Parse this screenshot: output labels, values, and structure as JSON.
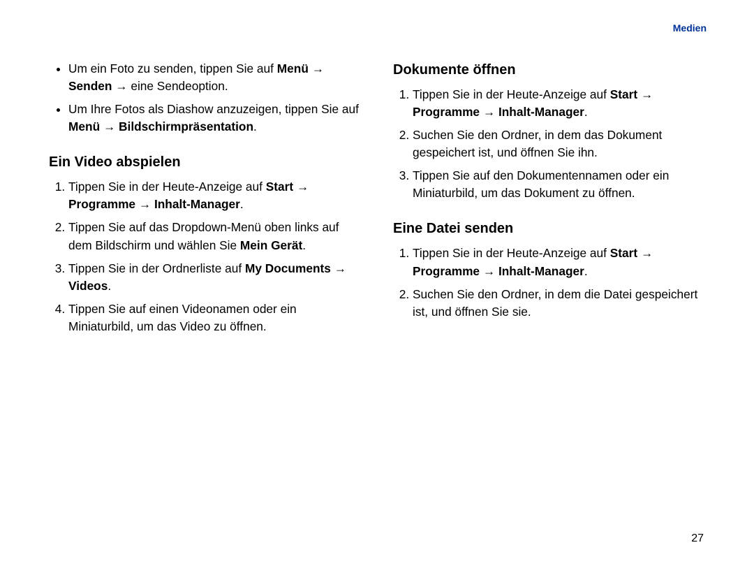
{
  "header": {
    "section_label": "Medien"
  },
  "page_number": "27",
  "arrow": "→",
  "left": {
    "bullets": [
      {
        "pre": "Um ein Foto zu senden, tippen Sie auf ",
        "b1": "Menü",
        "mid1": " ",
        "b2": "Senden",
        "mid2": " ",
        "post": "eine Sendeoption."
      },
      {
        "pre": "Um Ihre Fotos als Diashow anzuzeigen, tippen Sie auf ",
        "b1": "Menü",
        "mid1": " ",
        "b2": "Bildschirmpräsentation",
        "post": "."
      }
    ],
    "heading": "Ein Video abspielen",
    "steps": [
      {
        "pre": "Tippen Sie in der Heute-Anzeige auf ",
        "b1": "Start",
        "mid1": " ",
        "b2": "Programme",
        "mid2": " ",
        "b3": "Inhalt-Manager",
        "post": "."
      },
      {
        "pre": "Tippen Sie auf das Dropdown-Menü oben links auf dem Bildschirm und wählen Sie ",
        "b1": "Mein Gerät",
        "post": "."
      },
      {
        "pre": "Tippen Sie in der Ordnerliste auf ",
        "b1": "My Documents",
        "mid1": " ",
        "b2": "Videos",
        "post": "."
      },
      {
        "pre": "Tippen Sie auf einen Videonamen oder ein Miniaturbild, um das Video zu öffnen.",
        "post": ""
      }
    ]
  },
  "right": {
    "heading1": "Dokumente öffnen",
    "steps1": [
      {
        "pre": "Tippen Sie in der Heute-Anzeige auf ",
        "b1": "Start",
        "mid1": " ",
        "b2": "Programme",
        "mid2": " ",
        "b3": "Inhalt-Manager",
        "post": "."
      },
      {
        "pre": "Suchen Sie den Ordner, in dem das Dokument gespeichert ist, und öffnen Sie ihn.",
        "post": ""
      },
      {
        "pre": "Tippen Sie auf den Dokumentennamen oder ein Miniaturbild, um das Dokument zu öffnen.",
        "post": ""
      }
    ],
    "heading2": "Eine Datei senden",
    "steps2": [
      {
        "pre": "Tippen Sie in der Heute-Anzeige auf ",
        "b1": "Start",
        "mid1": " ",
        "b2": "Programme",
        "mid2": " ",
        "b3": "Inhalt-Manager",
        "post": "."
      },
      {
        "pre": "Suchen Sie den Ordner, in dem die Datei gespeichert ist, und öffnen Sie sie.",
        "post": ""
      }
    ]
  }
}
